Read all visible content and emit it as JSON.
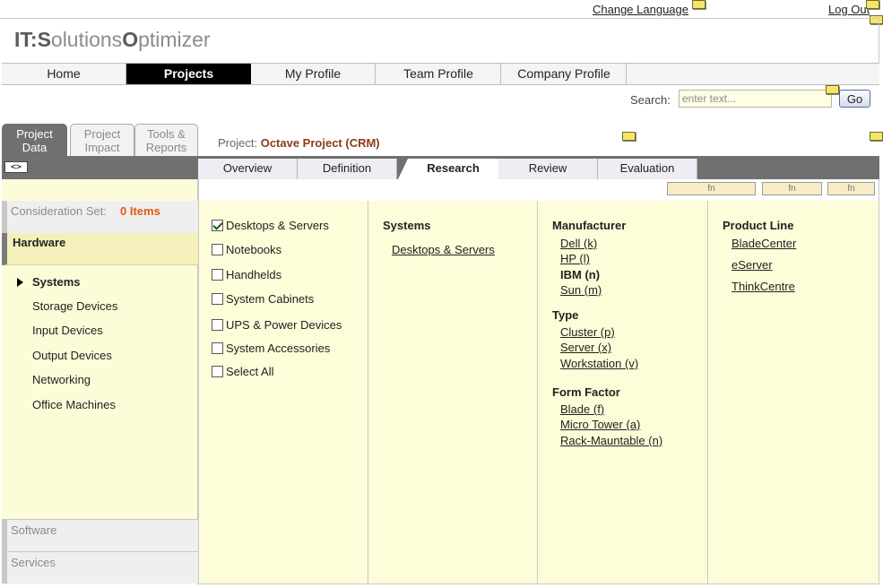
{
  "top_links": {
    "change_language": "Change Language",
    "log_out": "Log Out"
  },
  "logo": {
    "part1": "IT:",
    "part2": "S",
    "part3": "olutions",
    "part4": "O",
    "part5": "ptimizer"
  },
  "main_nav": [
    "Home",
    "Projects",
    "My Profile",
    "Team Profile",
    "Company Profile"
  ],
  "main_nav_active": "Projects",
  "search": {
    "label": "Search:",
    "placeholder": "enter text...",
    "button": "Go"
  },
  "side_tabs": [
    {
      "line1": "Project",
      "line2": "Data",
      "active": true
    },
    {
      "line1": "Project",
      "line2": "Impact",
      "active": false
    },
    {
      "line1": "Tools &",
      "line2": "Reports",
      "active": false
    }
  ],
  "toggle_label": "<>",
  "project": {
    "label": "Project:",
    "name": "Octave Project (CRM)"
  },
  "sub_tabs": [
    "Overview",
    "Definition",
    "Research",
    "Review",
    "Evaluation"
  ],
  "sub_tabs_active": "Research",
  "fn_buttons": [
    "fn",
    "fn",
    "fn"
  ],
  "consideration": {
    "label": "Consideration Set:",
    "count": "0 Items"
  },
  "categories": {
    "active": "Hardware",
    "sub_items": [
      "Systems",
      "Storage Devices",
      "Input Devices",
      "Output Devices",
      "Networking",
      "Office Machines"
    ],
    "selected_sub": "Systems",
    "collapsed": [
      "Software",
      "Services"
    ]
  },
  "checkbox_items": [
    {
      "label": "Desktops & Servers",
      "checked": true
    },
    {
      "label": "Notebooks",
      "checked": false
    },
    {
      "label": "Handhelds",
      "checked": false
    },
    {
      "label": "System Cabinets",
      "checked": false
    },
    {
      "label": "UPS & Power Devices",
      "checked": false
    },
    {
      "label": "System Accessories",
      "checked": false
    },
    {
      "label": "Select All",
      "checked": false
    }
  ],
  "systems_col": {
    "header": "Systems",
    "links": [
      "Desktops & Servers"
    ]
  },
  "manufacturer": {
    "header": "Manufacturer",
    "items": [
      "Dell (k)",
      "HP (l)",
      "IBM (n)",
      "Sun (m)"
    ],
    "selected": "IBM (n)"
  },
  "type": {
    "header": "Type",
    "items": [
      "Cluster (p)",
      "Server (x)",
      "Workstation (v)"
    ]
  },
  "form_factor": {
    "header": "Form Factor",
    "items": [
      "Blade (f)",
      "Micro Tower (a)",
      "Rack-Mauntable (n)"
    ]
  },
  "product_line": {
    "header": "Product Line",
    "items": [
      "BladeCenter",
      "eServer",
      "ThinkCentre"
    ]
  },
  "colors": {
    "active_tab_bg": "#000000",
    "tab_bar": "#707070",
    "panel_yellow": "#fdfdd9",
    "project_name": "#8b3a16",
    "items_count": "#e05a10",
    "note_icon": "#f7e56a"
  },
  "icons": [
    "note-icon",
    "checkbox",
    "arrow-right-icon"
  ]
}
